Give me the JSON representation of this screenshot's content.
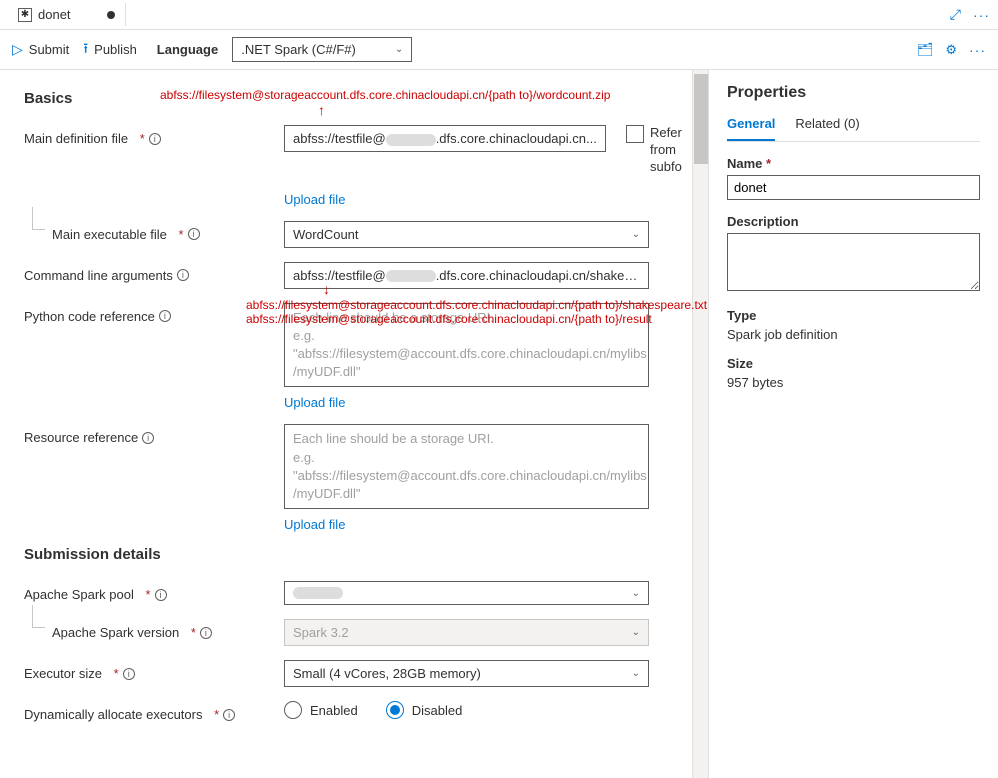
{
  "tab": {
    "title": "donet"
  },
  "toolbar": {
    "submit": "Submit",
    "publish": "Publish",
    "language_label": "Language",
    "language_value": ".NET Spark (C#/F#)"
  },
  "annotations": {
    "wordcount": "abfss://filesystem@storageaccount.dfs.core.chinacloudapi.cn/{path to}/wordcount.zip",
    "shakespeare": "abfss://filesystem@storageaccount.dfs.core.chinacloudapi.cn/{path to}/shakespeare.txt",
    "result": "abfss://filesystem@storageaccount.dfs.core.chinacloudapi.cn/{path to}/result"
  },
  "basics": {
    "title": "Basics",
    "main_def_label": "Main definition file",
    "main_def_value_prefix": "abfss://testfile@",
    "main_def_value_suffix": ".dfs.core.chinacloudapi.cn...",
    "ref_checkbox_lines": [
      "Refer",
      "from",
      "subfo"
    ],
    "upload_file": "Upload file",
    "main_exec_label": "Main executable file",
    "main_exec_value": "WordCount",
    "cmd_args_label": "Command line arguments",
    "cmd_args_value_prefix": "abfss://testfile@",
    "cmd_args_value_suffix": ".dfs.core.chinacloudapi.cn/shakesp...",
    "python_ref_label": "Python code reference",
    "python_ref_placeholder": "Each line should be a storage URI.\ne.g.\n\"abfss://filesystem@account.dfs.core.chinacloudapi.cn/mylibs/myUDF.dll\"",
    "resource_ref_label": "Resource reference",
    "resource_ref_placeholder": "Each line should be a storage URI.\ne.g.\n\"abfss://filesystem@account.dfs.core.chinacloudapi.cn/mylibs/myUDF.dll\""
  },
  "submission": {
    "title": "Submission details",
    "spark_pool_label": "Apache Spark pool",
    "spark_version_label": "Apache Spark version",
    "spark_version_value": "Spark 3.2",
    "executor_size_label": "Executor size",
    "executor_size_value": "Small (4 vCores, 28GB memory)",
    "dyn_alloc_label": "Dynamically allocate executors",
    "enabled": "Enabled",
    "disabled": "Disabled"
  },
  "properties": {
    "title": "Properties",
    "tab_general": "General",
    "tab_related": "Related (0)",
    "name_label": "Name",
    "name_value": "donet",
    "desc_label": "Description",
    "type_label": "Type",
    "type_value": "Spark job definition",
    "size_label": "Size",
    "size_value": "957 bytes"
  }
}
